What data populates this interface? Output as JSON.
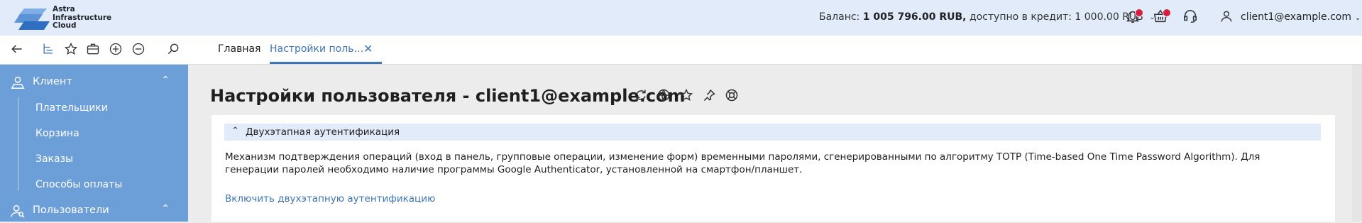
{
  "header": {
    "logo_lines": [
      "Astra",
      "Infrastructure",
      "Cloud"
    ],
    "balance_label": "Баланс:",
    "balance_value": "1 005 796.00 RUB,",
    "credit_label": "доступно в кредит:",
    "credit_value": "1 000.00 RUB",
    "user_email": "client1@example.com"
  },
  "tabs": {
    "home": "Главная",
    "active": "Настройки поль…",
    "close": "✕"
  },
  "sidebar": {
    "client_label": "Клиент",
    "client_items": [
      "Плательщики",
      "Корзина",
      "Заказы",
      "Способы оплаты"
    ],
    "users_label": "Пользователи"
  },
  "page": {
    "title": "Настройки пользователя - client1@example.com",
    "section_title": "Двухэтапная аутентификация",
    "description": "Механизм подтверждения операций (вход в панель, групповые операции, изменение форм) временными паролями, сгенерированными по алгоритму TOTP (Time-based One Time Password Algorithm). Для генерации паролей необходимо наличие программы Google Authenticator, установленной на смартфон/планшет.",
    "enable_link": "Включить двухэтапную аутентификацию"
  },
  "colors": {
    "header_bg": "#e1ebfa",
    "sidebar_bg": "#6c9fd8",
    "accent": "#3f76b3",
    "badge": "#d81d3f"
  },
  "icons": [
    "back-icon",
    "tree-icon",
    "star-icon",
    "briefcase-icon",
    "plus-circle-icon",
    "minus-circle-icon",
    "search-icon",
    "bell-icon",
    "basket-icon",
    "headset-icon",
    "user-icon",
    "refresh-icon",
    "globe-icon",
    "pin-icon",
    "lifebuoy-icon"
  ]
}
